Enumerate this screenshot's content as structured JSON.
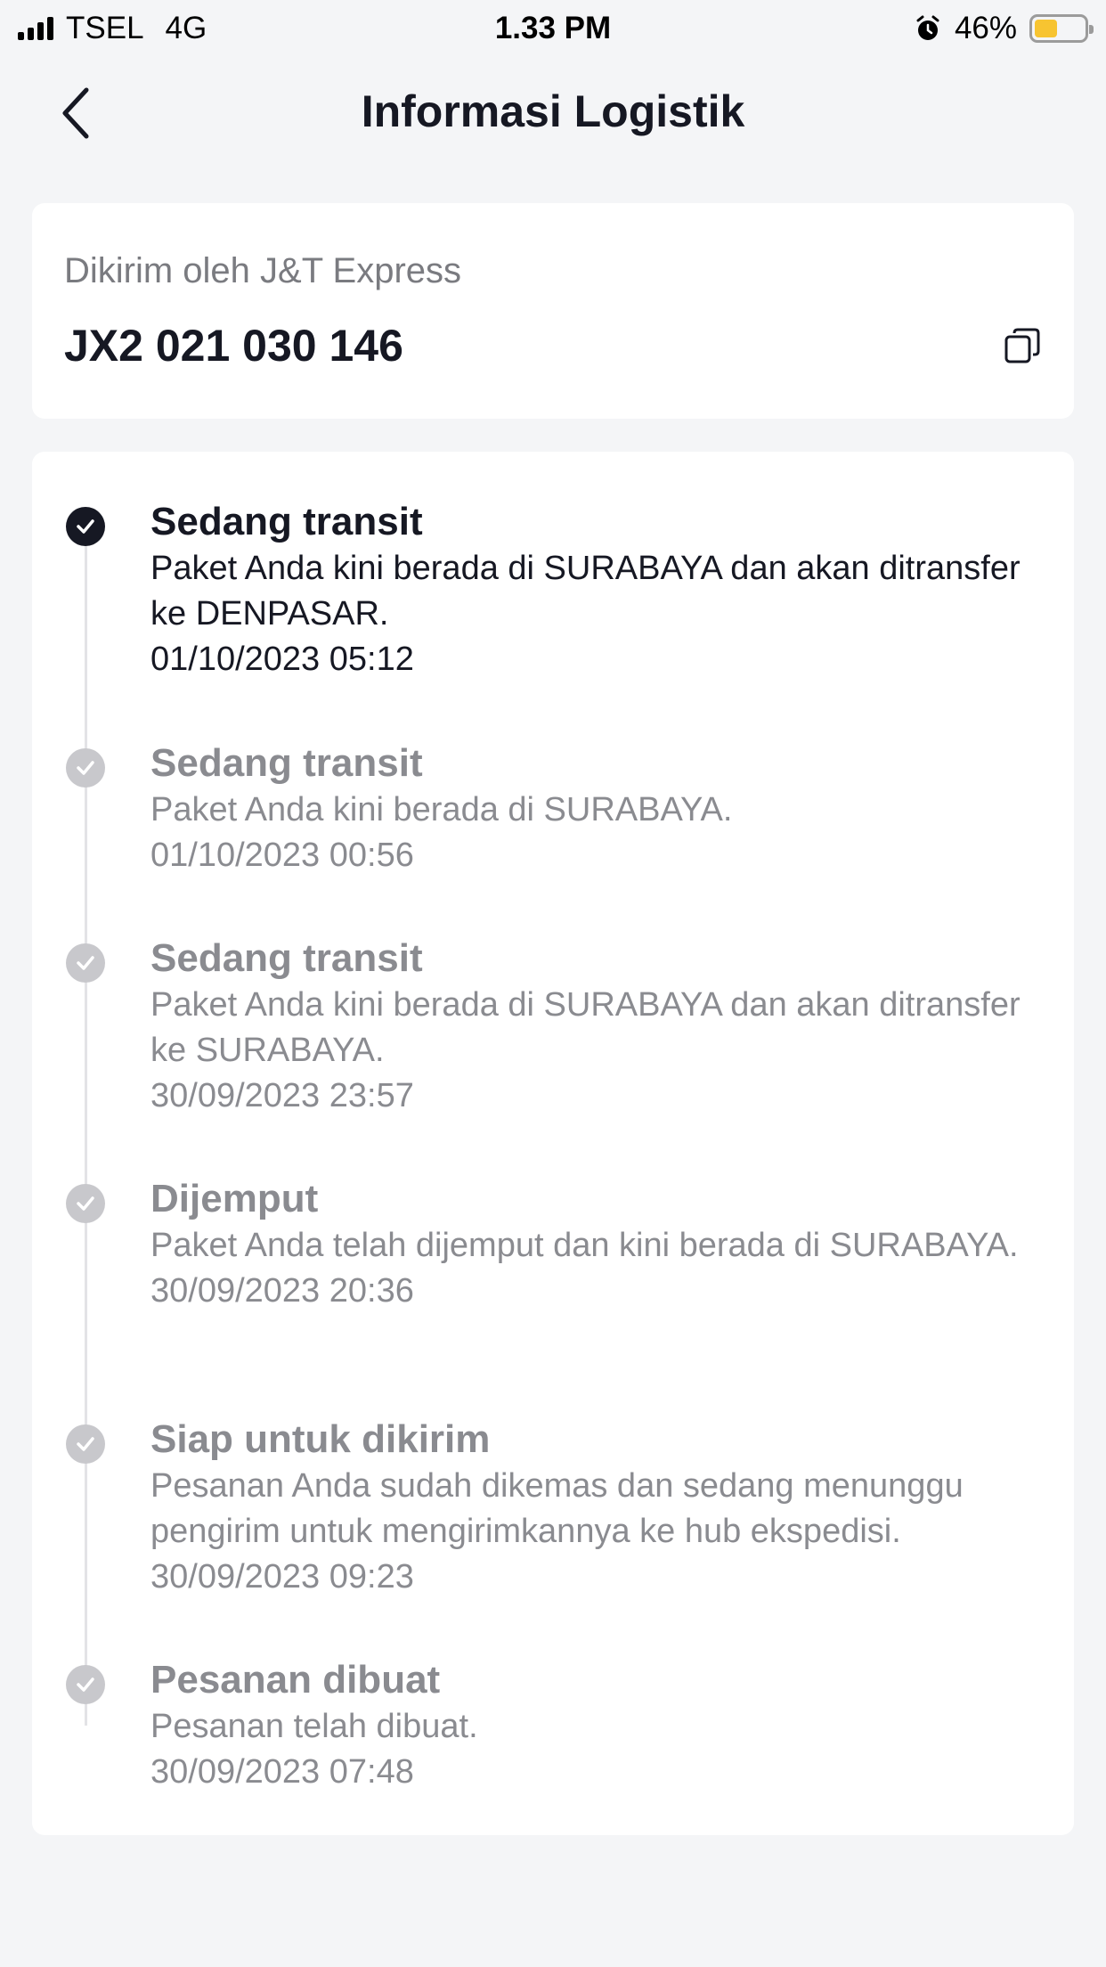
{
  "status_bar": {
    "carrier": "TSEL",
    "network": "4G",
    "time": "1.33 PM",
    "battery": "46%",
    "battery_level": 0.46
  },
  "header": {
    "title": "Informasi Logistik"
  },
  "shipment": {
    "label": "Dikirim oleh J&T Express",
    "tracking_number": "JX2 021 030 146"
  },
  "timeline": [
    {
      "title": "Sedang transit",
      "description": "Paket Anda kini berada di SURABAYA dan akan ditransfer ke DENPASAR.",
      "time": "01/10/2023 05:12",
      "active": true
    },
    {
      "title": "Sedang transit",
      "description": "Paket Anda kini berada di SURABAYA.",
      "time": "01/10/2023 00:56",
      "active": false
    },
    {
      "title": "Sedang transit",
      "description": "Paket Anda kini berada di SURABAYA dan akan ditransfer ke SURABAYA.",
      "time": "30/09/2023 23:57",
      "active": false
    },
    {
      "title": "Dijemput",
      "description": "Paket Anda telah dijemput dan kini berada di SURABAYA.",
      "time": "30/09/2023 20:36",
      "active": false
    },
    {
      "title": "Siap untuk dikirim",
      "description": "Pesanan Anda sudah dikemas dan sedang menunggu pengirim untuk mengirimkannya ke hub ekspedisi.",
      "time": "30/09/2023 09:23",
      "active": false
    },
    {
      "title": "Pesanan dibuat",
      "description": "Pesanan telah dibuat.",
      "time": "30/09/2023 07:48",
      "active": false
    }
  ],
  "colors": {
    "background": "#f4f5f7",
    "card": "#ffffff",
    "text_primary": "#161823",
    "text_secondary": "#8a8b90",
    "battery": "#f7c431"
  }
}
